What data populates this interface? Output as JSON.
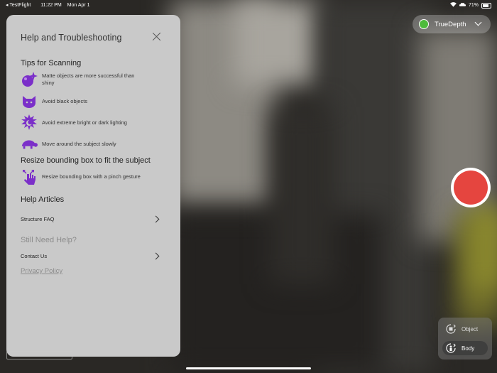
{
  "status_bar": {
    "app": "TestFlight",
    "time": "11:22 PM",
    "date": "Mon Apr 1",
    "battery": "71%"
  },
  "help_panel": {
    "title": "Help and Troubleshooting",
    "tips_heading": "Tips for Scanning",
    "tips": [
      {
        "icon": "sparkle-ball-icon",
        "text": "Matte objects are more successful than shiny"
      },
      {
        "icon": "cat-icon",
        "text": "Avoid black objects"
      },
      {
        "icon": "sun-moon-icon",
        "text": "Avoid extreme bright or dark lighting"
      },
      {
        "icon": "turtle-icon",
        "text": "Move around the subject slowly"
      }
    ],
    "resize_heading": "Resize bounding box to fit the subject",
    "resize_tip": {
      "icon": "pinch-gesture-icon",
      "text": "Resize bounding box with a pinch gesture"
    },
    "articles_heading": "Help Articles",
    "faq_label": "Structure FAQ",
    "need_help_heading": "Still Need Help?",
    "contact_label": "Contact Us",
    "privacy_label": "Privacy Policy"
  },
  "camera_picker": {
    "label": "TrueDepth"
  },
  "modes": {
    "object_label": "Object",
    "body_label": "Body",
    "active": "Body"
  },
  "colors": {
    "accent": "#7b2fc9",
    "record": "#e5453f",
    "status_dot": "#4dbb3b"
  }
}
